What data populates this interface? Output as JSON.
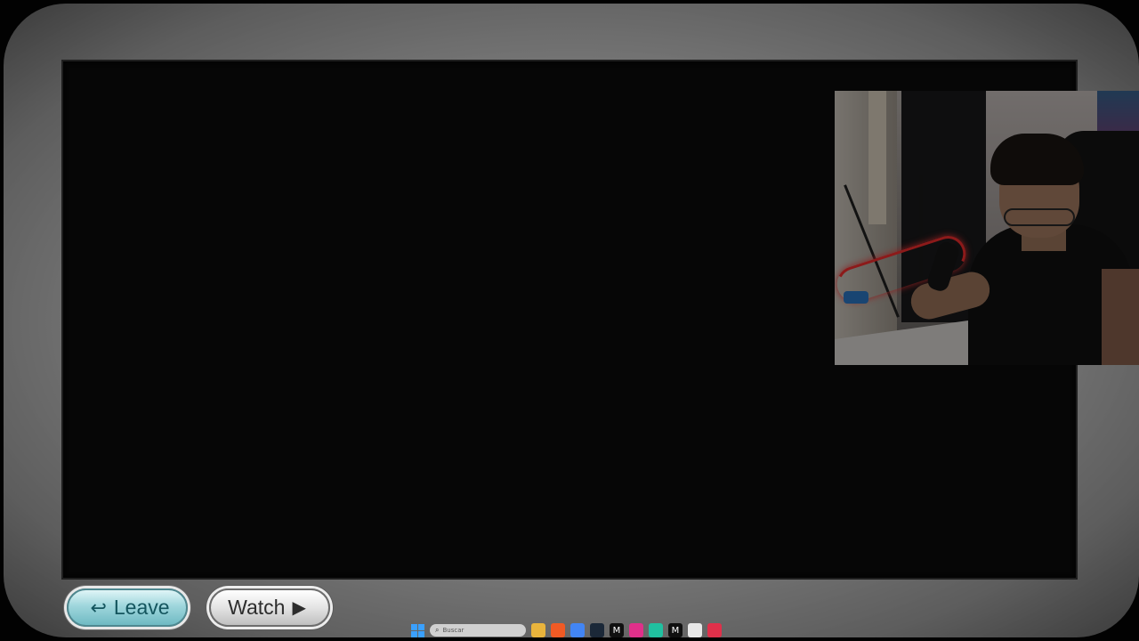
{
  "buttons": {
    "leave_label": "Leave",
    "leave_glyph": "↩",
    "watch_label": "Watch",
    "watch_glyph": "▶"
  },
  "taskbar": {
    "search_placeholder": "Buscar",
    "search_glyph": "⌕",
    "apps": [
      {
        "name": "file-explorer-icon",
        "color": "#e9b43c",
        "glyph": ""
      },
      {
        "name": "app-orange-icon",
        "color": "#f05a24",
        "glyph": ""
      },
      {
        "name": "chrome-icon",
        "color": "#4285f4",
        "glyph": ""
      },
      {
        "name": "steam-icon",
        "color": "#1b2838",
        "glyph": ""
      },
      {
        "name": "app-m-icon",
        "color": "#101010",
        "glyph": "M"
      },
      {
        "name": "app-pink-icon",
        "color": "#e0308a",
        "glyph": ""
      },
      {
        "name": "app-green-icon",
        "color": "#20c0a0",
        "glyph": ""
      },
      {
        "name": "app-m2-icon",
        "color": "#101010",
        "glyph": "M"
      },
      {
        "name": "app-white-icon",
        "color": "#e8e8e8",
        "glyph": ""
      },
      {
        "name": "app-red-icon",
        "color": "#e0304a",
        "glyph": ""
      }
    ]
  },
  "colors": {
    "leave_accent": "#6fbac3",
    "watch_accent": "#bfbfbf",
    "screen_bg": "#0b0b0b"
  }
}
